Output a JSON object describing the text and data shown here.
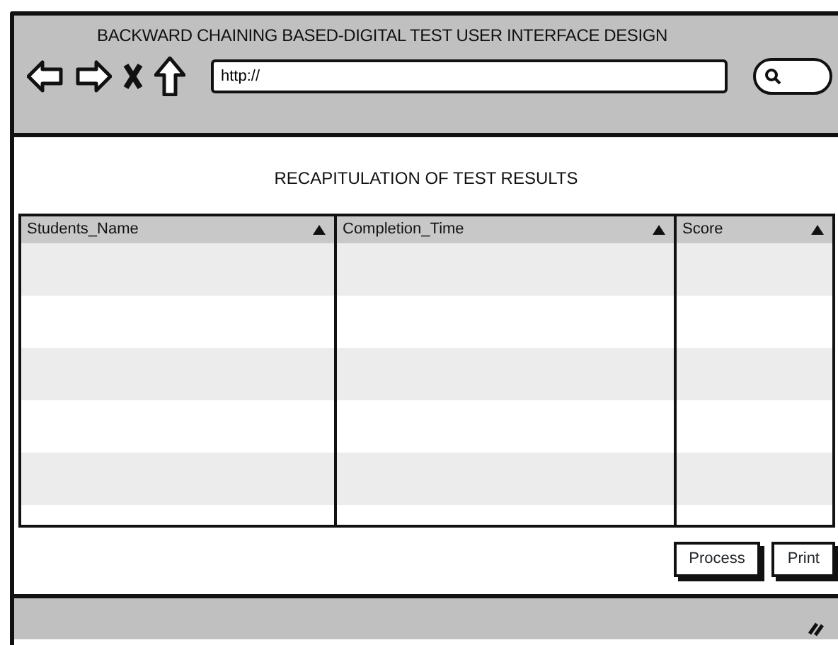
{
  "window": {
    "title": "BACKWARD CHAINING BASED-DIGITAL TEST USER INTERFACE DESIGN"
  },
  "address_bar": {
    "value": "http://"
  },
  "page_title": "RECAPITULATION OF TEST RESULTS",
  "table": {
    "columns": [
      "Students_Name",
      "Completion_Time",
      "Score"
    ]
  },
  "buttons": [
    "Process",
    "Print"
  ]
}
